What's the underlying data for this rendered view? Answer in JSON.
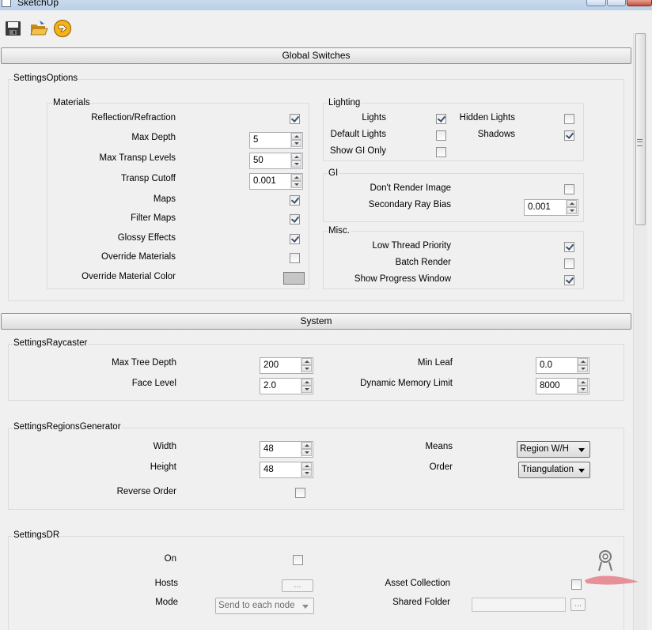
{
  "window": {
    "title": "SketchUp"
  },
  "toolbar": {
    "icons": [
      "save-icon",
      "open-folder-icon",
      "sketchup-logo-icon"
    ]
  },
  "sections": {
    "global_switches": "Global Switches",
    "system": "System"
  },
  "settings_options": {
    "title": "SettingsOptions",
    "materials": {
      "title": "Materials",
      "reflection_refraction": {
        "label": "Reflection/Refraction",
        "checked": true
      },
      "max_depth": {
        "label": "Max Depth",
        "value": "5"
      },
      "max_transp_levels": {
        "label": "Max Transp Levels",
        "value": "50"
      },
      "transp_cutoff": {
        "label": "Transp Cutoff",
        "value": "0.001"
      },
      "maps": {
        "label": "Maps",
        "checked": true
      },
      "filter_maps": {
        "label": "Filter Maps",
        "checked": true
      },
      "glossy_effects": {
        "label": "Glossy Effects",
        "checked": true
      },
      "override_materials": {
        "label": "Override Materials",
        "checked": false
      },
      "override_material_color": {
        "label": "Override Material Color",
        "color": "#c6c6c6"
      }
    },
    "lighting": {
      "title": "Lighting",
      "lights": {
        "label": "Lights",
        "checked": true
      },
      "hidden_lights": {
        "label": "Hidden Lights",
        "checked": false
      },
      "default_lights": {
        "label": "Default Lights",
        "checked": false
      },
      "shadows": {
        "label": "Shadows",
        "checked": true
      },
      "show_gi_only": {
        "label": "Show GI Only",
        "checked": false
      }
    },
    "gi": {
      "title": "GI",
      "dont_render_image": {
        "label": "Don't Render Image",
        "checked": false
      },
      "secondary_ray_bias": {
        "label": "Secondary Ray Bias",
        "value": "0.001"
      }
    },
    "misc": {
      "title": "Misc.",
      "low_thread_priority": {
        "label": "Low Thread Priority",
        "checked": true
      },
      "batch_render": {
        "label": "Batch Render",
        "checked": false
      },
      "show_progress_window": {
        "label": "Show Progress Window",
        "checked": true
      }
    }
  },
  "raycaster": {
    "title": "SettingsRaycaster",
    "max_tree_depth": {
      "label": "Max Tree Depth",
      "value": "200"
    },
    "min_leaf": {
      "label": "Min Leaf",
      "value": "0.0"
    },
    "face_level": {
      "label": "Face Level",
      "value": "2.0"
    },
    "dynamic_memory_limit": {
      "label": "Dynamic Memory Limit",
      "value": "8000"
    }
  },
  "regions": {
    "title": "SettingsRegionsGenerator",
    "width": {
      "label": "Width",
      "value": "48"
    },
    "means": {
      "label": "Means",
      "value": "Region W/H"
    },
    "height": {
      "label": "Height",
      "value": "48"
    },
    "order": {
      "label": "Order",
      "value": "Triangulation"
    },
    "reverse_order": {
      "label": "Reverse Order",
      "checked": false
    }
  },
  "dr": {
    "title": "SettingsDR",
    "on": {
      "label": "On",
      "checked": false
    },
    "hosts": {
      "label": "Hosts",
      "button": "..."
    },
    "asset_collection": {
      "label": "Asset Collection",
      "checked": false
    },
    "mode": {
      "label": "Mode",
      "value": "Send to each node"
    },
    "shared_folder": {
      "label": "Shared Folder",
      "value": "",
      "button": "..."
    }
  }
}
